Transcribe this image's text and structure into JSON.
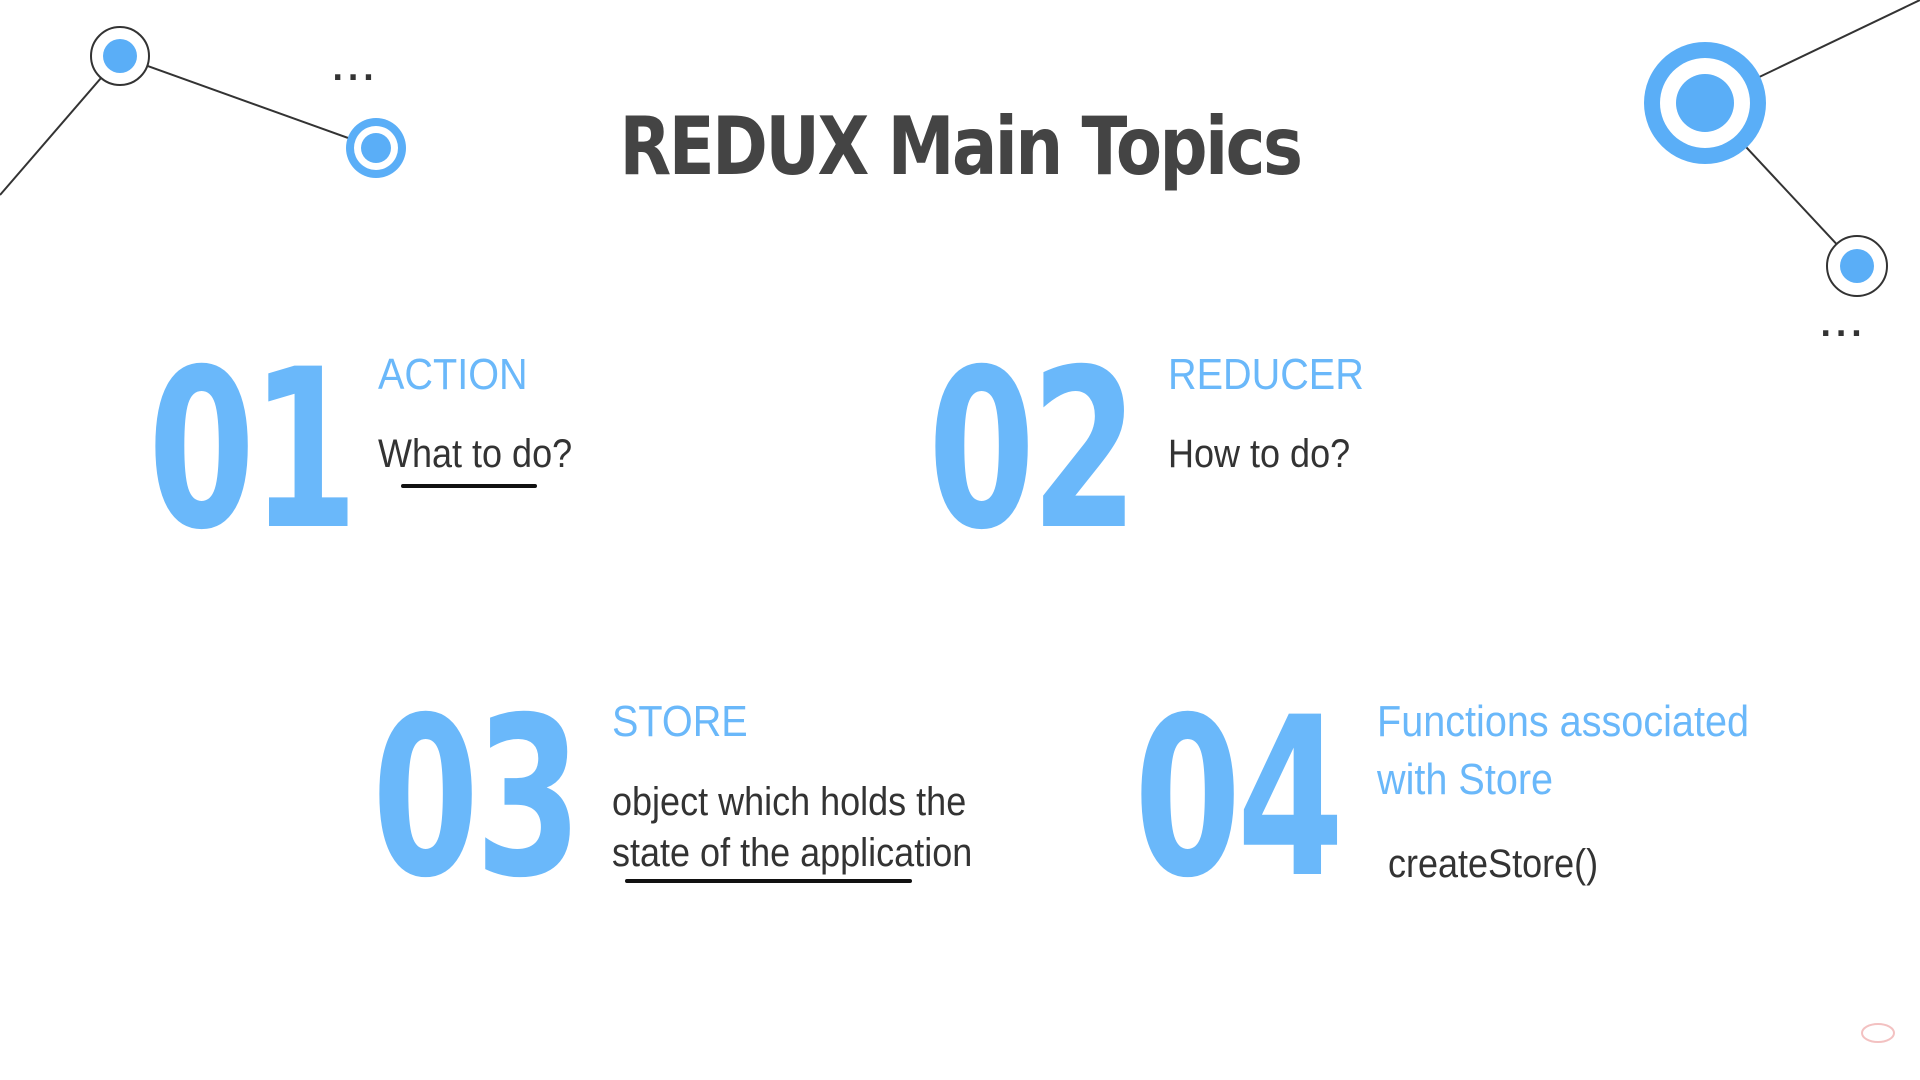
{
  "slide": {
    "title": "REDUX Main Topics",
    "accent_color": "#6ab8fa",
    "decor_circle_color": "#5aaef7",
    "text_color": "#333333",
    "title_color": "#444444",
    "topics": [
      {
        "number": "01",
        "heading": "ACTION",
        "description": "What to do?"
      },
      {
        "number": "02",
        "heading": "REDUCER",
        "description": "How to do?"
      },
      {
        "number": "03",
        "heading": "STORE",
        "description_line1": "object which holds the",
        "description_line2": "state of the application"
      },
      {
        "number": "04",
        "heading_line1": "Functions associated",
        "heading_line2": "with Store",
        "description": "createStore()"
      }
    ]
  },
  "decor": {
    "ellipsis": "..."
  }
}
